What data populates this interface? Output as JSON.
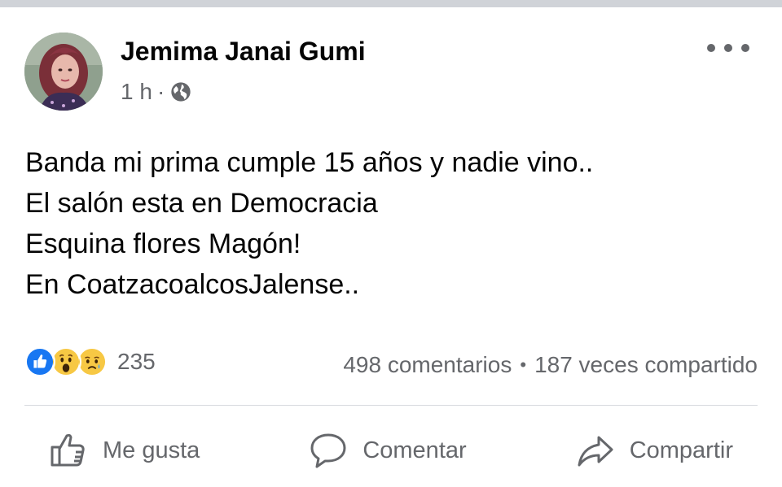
{
  "post": {
    "author": "Jemima Janai Gumi",
    "time": "1 h",
    "separator": "·",
    "privacy_icon": "globe-icon",
    "more_icon": "more-options-icon",
    "body_lines": [
      "Banda mi prima cumple 15 años y nadie vino..",
      "El salón esta en Democracia",
      "Esquina flores Magón!",
      "En CoatzacoalcosJalense.."
    ]
  },
  "reactions": {
    "icons": [
      "like-icon",
      "wow-icon",
      "sad-icon"
    ],
    "count": "235"
  },
  "stats": {
    "comments": "498 comentarios",
    "separator": "•",
    "shares": "187 veces compartido"
  },
  "actions": {
    "like_label": "Me gusta",
    "comment_label": "Comentar",
    "share_label": "Compartir"
  },
  "colors": {
    "like_blue": "#1877f2",
    "emoji_yellow": "#f7c844",
    "secondary_text": "#65676b",
    "primary_text": "#050505"
  }
}
